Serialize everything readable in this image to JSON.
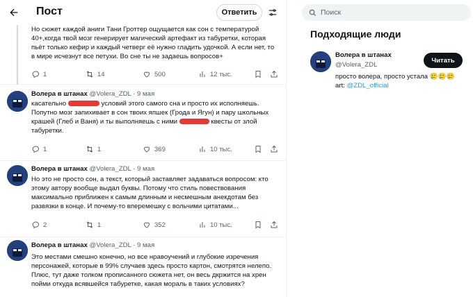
{
  "header": {
    "title": "Пост",
    "reply_button": "Ответить"
  },
  "tweets": [
    {
      "body": "Но сюжет каждой аниги Тани Гроттер ощущается как сон с температурой 40+,когда твой мозг генерирует магический артефакт из табуретки, которая пьёт только кефир и каждый четверг её нужно гладить удочкой. А если нет, то в мире исчезнут все петухи. Во сне ты не задаешь вопросов+",
      "replies": "1",
      "retweets": "14",
      "likes": "",
      "views": "500",
      "bookmarks": "12 тыс."
    },
    {
      "name": "Волера в штанах",
      "handle": "@Volera_ZDL",
      "date": "· 9 мая",
      "body_1": "касательно ",
      "body_2": " условий этого самого сна и просто их исполняешь. Попутно мозг запихивает в сон твоих япшек (Грода и Ягун) и пару школьных крашей (Глеб и Ваня) и ты выполняешь с ними ",
      "body_3": " квесты от злой табуретки.",
      "replies": "1",
      "retweets": "1",
      "likes": "",
      "views": "369",
      "bookmarks": "10 тыс."
    },
    {
      "name": "Волера в штанах",
      "handle": "@Volera_ZDL",
      "date": "· 9 мая",
      "body": "Но это не просто сон, а текст, который заставляет задаваться вопросом: кто этому автору вообще выдал буквы. Потому что стиль повествования максимально приближен к самым длинным и несмешным анекдотам без развязки в конце. И почему-то вперемешку с вольчими цитатами...",
      "replies": "2",
      "retweets": "1",
      "likes": "",
      "views": "352",
      "bookmarks": "10 тыс."
    },
    {
      "name": "Волера в штанах",
      "handle": "@Volera_ZDL",
      "date": "· 9 мая",
      "body": "Это местами смешно конечно, но все нравоучений и глубокие изречения персонажей, которые в 99% случаев здесь просто картон, смотрятся нелепо. Плюс, тут даже толком прописанного сюжета нет, он весь дкржится на хрен пойми откуда всявшейся табуретке, какая мораль в таких условиях?"
    }
  ],
  "sidebar": {
    "search_placeholder": "Поиск",
    "panel_title": "Подходящие люди",
    "person": {
      "name": "Волера в штанах",
      "handle": "@Volera_ZDL",
      "follow_label": "Читать",
      "bio": "просто волера, просто устала 🥲🥲🥲",
      "bio_art_prefix": "art: ",
      "bio_art_link": "@ZDL_official"
    }
  },
  "colors": {
    "accent": "#1d9bf0",
    "avatar": "#22407e",
    "redaction": "#e53935",
    "muted_text": "#536471"
  }
}
